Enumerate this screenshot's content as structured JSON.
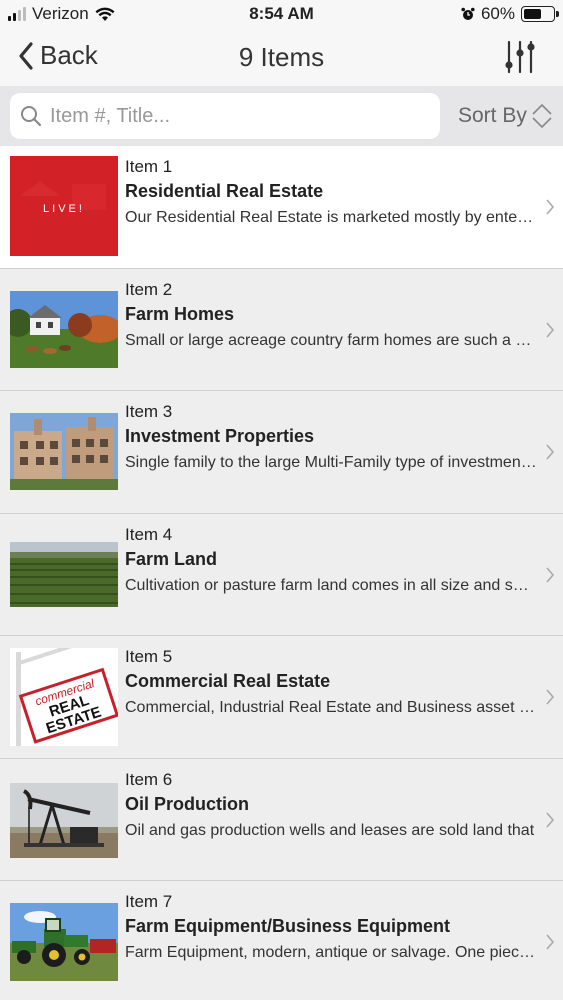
{
  "status_bar": {
    "carrier": "Verizon",
    "time": "8:54 AM",
    "battery_text": "60%",
    "battery_level": 0.6
  },
  "nav": {
    "back_label": "Back",
    "title": "9 Items"
  },
  "search": {
    "placeholder": "Item #, Title...",
    "value": "",
    "sort_label": "Sort By"
  },
  "items": [
    {
      "number": "Item 1",
      "title": "Residential Real Estate",
      "description": "Our Residential Real Estate is marketed mostly by entering the live auction",
      "image": "live-banner-image",
      "live_text": "LIVE!"
    },
    {
      "number": "Item 2",
      "title": "Farm Homes",
      "description": "Small or large acreage country farm homes are such a home for",
      "image": "farm-house-photo"
    },
    {
      "number": "Item 3",
      "title": "Investment Properties",
      "description": "Single family to the large Multi-Family type of investment properties",
      "image": "apartment-building-photo"
    },
    {
      "number": "Item 4",
      "title": "Farm Land",
      "description": "Cultivation or pasture farm land comes in all size and shapes",
      "image": "farm-field-photo"
    },
    {
      "number": "Item 5",
      "title": "Commercial Real Estate",
      "description": "Commercial, Industrial Real Estate and Business asset listings",
      "image": "commercial-sign-photo",
      "sign_text_1": "commercial",
      "sign_text_2": "REAL",
      "sign_text_3": "ESTATE"
    },
    {
      "number": "Item 6",
      "title": "Oil Production",
      "description": "Oil and gas production wells and leases are sold land that",
      "image": "oil-pump-photo"
    },
    {
      "number": "Item 7",
      "title": "Farm Equipment/Business Equipment",
      "description": "Farm Equipment, modern, antique or salvage. One piece or many",
      "image": "tractor-photo"
    }
  ],
  "colors": {
    "live_red": "#d9262a",
    "sign_red": "#c8202a"
  }
}
